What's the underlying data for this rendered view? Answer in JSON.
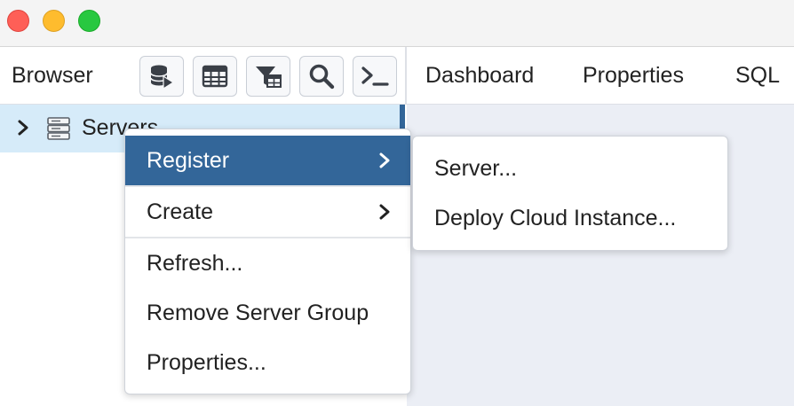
{
  "window": {
    "controls": [
      "close",
      "minimize",
      "maximize"
    ]
  },
  "browser": {
    "title": "Browser",
    "toolbar": [
      {
        "icon": "database-play-icon"
      },
      {
        "icon": "table-icon"
      },
      {
        "icon": "filter-table-icon"
      },
      {
        "icon": "search-icon"
      },
      {
        "icon": "terminal-icon"
      }
    ],
    "tree": {
      "items": [
        {
          "label": "Servers",
          "expanded": false,
          "selected": true
        }
      ]
    }
  },
  "tabs": [
    {
      "label": "Dashboard"
    },
    {
      "label": "Properties"
    },
    {
      "label": "SQL"
    }
  ],
  "context_menu": {
    "items": [
      {
        "label": "Register",
        "has_submenu": true,
        "active": true
      },
      {
        "label": "Create",
        "has_submenu": true,
        "active": false
      },
      {
        "label": "Refresh...",
        "has_submenu": false,
        "active": false
      },
      {
        "label": "Remove Server Group",
        "has_submenu": false,
        "active": false
      },
      {
        "label": "Properties...",
        "has_submenu": false,
        "active": false
      }
    ]
  },
  "submenu": {
    "items": [
      {
        "label": "Server..."
      },
      {
        "label": "Deploy Cloud Instance..."
      }
    ]
  },
  "colors": {
    "accent": "#336699",
    "selected_row": "#d6ebf9",
    "panel_bg": "#ebeef5",
    "close": "#fe5f57",
    "minimize": "#febc2e",
    "maximize": "#28c840"
  }
}
